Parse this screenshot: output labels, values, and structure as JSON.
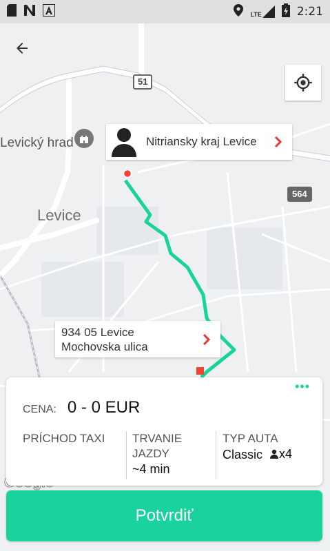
{
  "status_bar": {
    "time": "2:21",
    "network": "LTE"
  },
  "map": {
    "labels": {
      "castle": "Levický hrad",
      "town": "Levice"
    },
    "road_shields": {
      "r51": "51",
      "r564": "564"
    },
    "pickup": {
      "label": "Nitriansky kraj Levice"
    },
    "destination": {
      "line1": "934 05 Levice",
      "line2": "Mochovska ulica"
    },
    "google_logo": "Google"
  },
  "ride_card": {
    "price_label": "CENA:",
    "price_value": "0 - 0 EUR",
    "arrival_label": "PRÍCHOD TAXI",
    "duration_label": "TRVANIE JAZDY",
    "duration_value": "~4 min",
    "car_type_label": "TYP AUTA",
    "car_type_value": "Classic",
    "seats": "x4"
  },
  "confirm_button": "Potvrdiť",
  "colors": {
    "accent": "#1ad39c",
    "pin": "#f44336"
  }
}
